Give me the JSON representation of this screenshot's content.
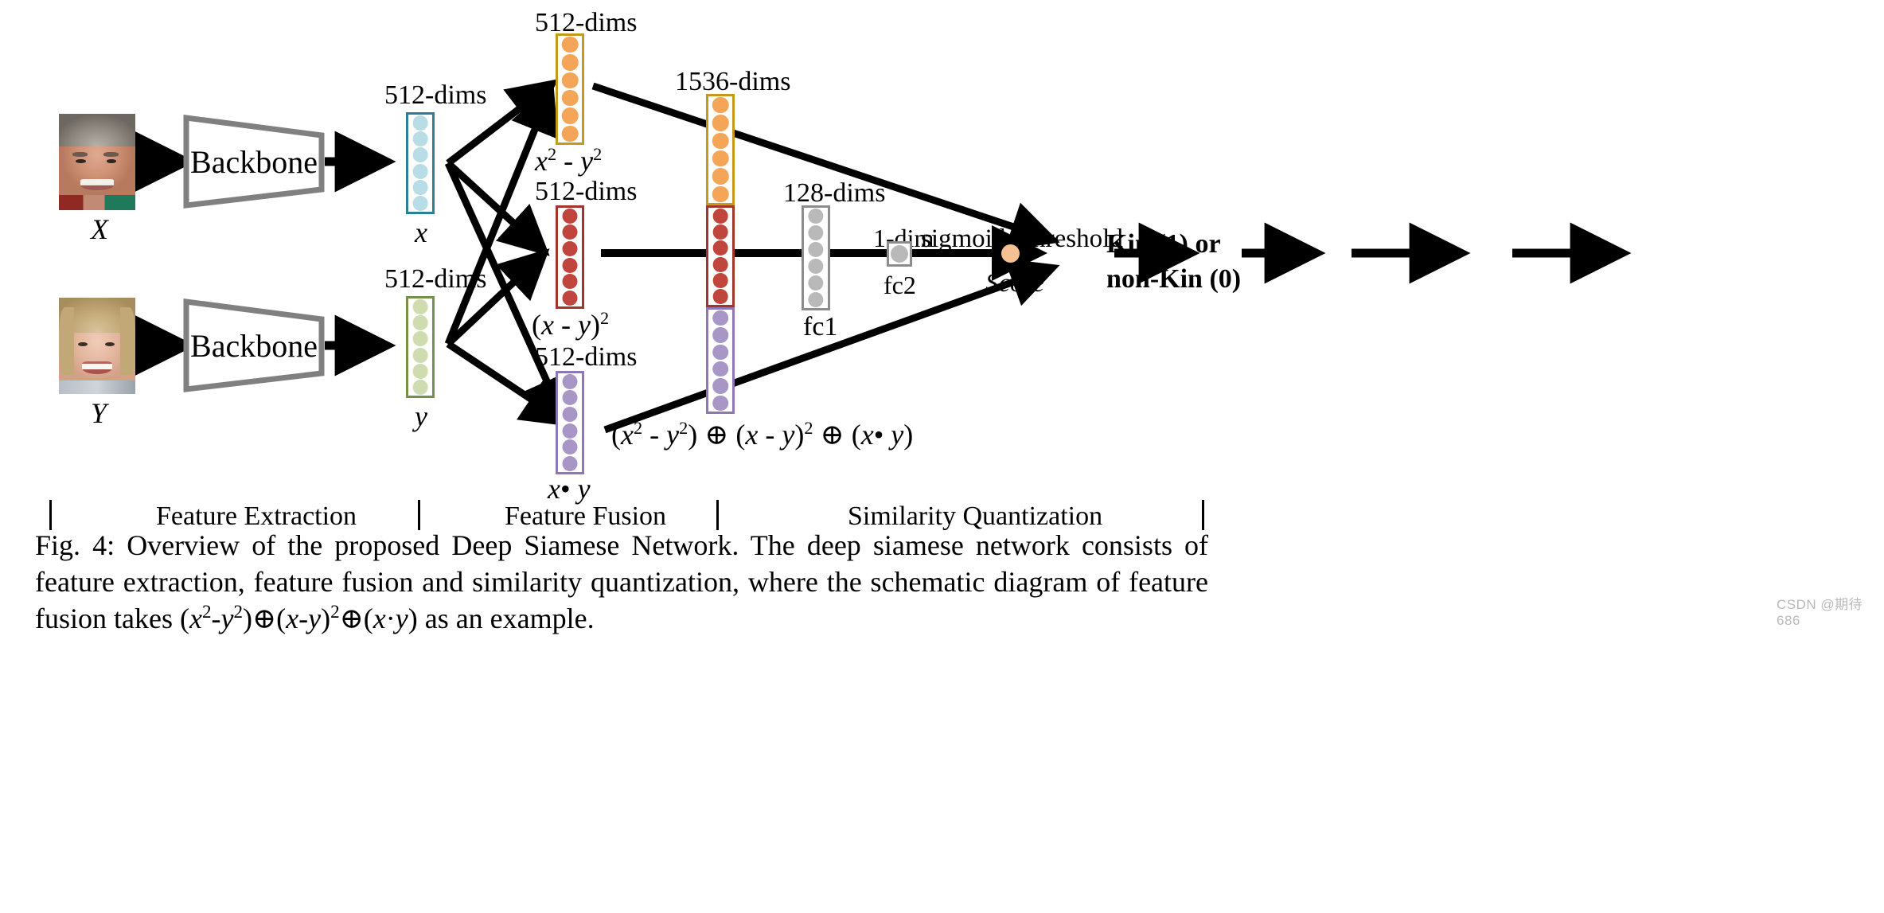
{
  "figure": {
    "id": "fig-4",
    "caption_prefix": "Fig. 4:",
    "caption_line1": "Overview of the proposed Deep Siamese Network. The deep siamese network consists of feature extraction, feature",
    "caption_line2_a": "fusion and similarity quantization, where the schematic diagram of feature fusion takes (",
    "caption_formula": "(x²-y²)⊕(x-y)²⊕(x·y)",
    "caption_line2_b": ") as an example.",
    "watermark": "CSDN @期待686"
  },
  "inputs": [
    {
      "id": "face-x",
      "label": "X"
    },
    {
      "id": "face-y",
      "label": "Y"
    }
  ],
  "backbones": [
    {
      "id": "backbone-top",
      "label": "Backbone"
    },
    {
      "id": "backbone-bottom",
      "label": "Backbone"
    }
  ],
  "embeddings": [
    {
      "id": "emb-x",
      "dims_label": "512-dims",
      "name": "x",
      "color": "#b9dde6",
      "border": "#2e7f96",
      "dots": 6
    },
    {
      "id": "emb-y",
      "dims_label": "512-dims",
      "name": "y",
      "color": "#cfdcb0",
      "border": "#74904a",
      "dots": 6
    }
  ],
  "fusion_vectors": [
    {
      "id": "fusion-sqdiff",
      "dims_label": "512-dims",
      "name": "x² - y²",
      "color": "#f4a košt",
      "border": "#c39a1a",
      "dots": 6
    },
    {
      "id": "fusion-diffsq",
      "dims_label": "512-dims",
      "name": "(x - y)²",
      "color": "#c0453c",
      "border": "#a2342c",
      "dots": 6
    },
    {
      "id": "fusion-prod",
      "dims_label": "512-dims",
      "name": "x• y",
      "color": "#a896c6",
      "border": "#8e77b4",
      "dots": 6
    }
  ],
  "concat_vector": {
    "id": "concat-1536",
    "dims_label": "1536-dims",
    "formula": "(x² - y²) ⊕ (x - y)² ⊕ (x• y)",
    "segments": [
      {
        "color": "#f4a558",
        "border": "#c39a1a",
        "dots": 6
      },
      {
        "color": "#c0453c",
        "border": "#a2342c",
        "dots": 6
      },
      {
        "color": "#a896c6",
        "border": "#8e77b4",
        "dots": 6
      }
    ]
  },
  "fc_layers": [
    {
      "id": "fc1",
      "dims_label": "128-dims",
      "name": "fc1",
      "color": "#b9b9b9",
      "border": "#8c8c8c",
      "dots": 6
    },
    {
      "id": "fc2",
      "dims_label": "1-dim",
      "name": "fc2",
      "color": "#b9b9b9",
      "border": "#8c8c8c",
      "dots": 1
    }
  ],
  "operations": [
    {
      "id": "op-sigmoid",
      "label": "sigmoid"
    },
    {
      "id": "op-threshold",
      "label": "threshold"
    }
  ],
  "score": {
    "id": "score-node",
    "label": "Score",
    "color": "#f5c193"
  },
  "output": {
    "id": "output-decision",
    "line1": "Kin (1) or",
    "line2": "non-Kin (0)"
  },
  "stages": [
    {
      "id": "stage-feature-extraction",
      "label": "Feature Extraction"
    },
    {
      "id": "stage-feature-fusion",
      "label": "Feature Fusion"
    },
    {
      "id": "stage-similarity-quantization",
      "label": "Similarity Quantization"
    }
  ],
  "colors": {
    "blue_fill": "#b9dde6",
    "blue_border": "#2e7f96",
    "green_fill": "#cfdcb0",
    "green_border": "#74904a",
    "orange_fill": "#f4a558",
    "orange_border": "#c39a1a",
    "red_fill": "#c0453c",
    "red_border": "#a2342c",
    "purple_fill": "#a896c6",
    "purple_border": "#8e77b4",
    "gray_fill": "#b9b9b9",
    "gray_border": "#8c8c8c",
    "score_fill": "#f5c193",
    "arrow": "#000000",
    "backbone_stroke": "#808080"
  }
}
